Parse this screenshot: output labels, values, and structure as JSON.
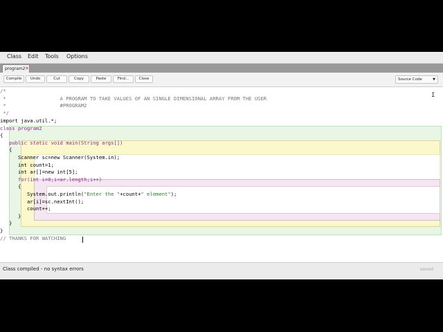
{
  "menu": [
    {
      "label": "Class"
    },
    {
      "label": "Edit"
    },
    {
      "label": "Tools"
    },
    {
      "label": "Options"
    }
  ],
  "tab": {
    "label": "program2",
    "close": "✕"
  },
  "toolbar": {
    "buttons": [
      {
        "label": "Compile"
      },
      {
        "label": "Undo"
      },
      {
        "label": "Cut"
      },
      {
        "label": "Copy"
      },
      {
        "label": "Paste"
      },
      {
        "label": "Find..."
      },
      {
        "label": "Close"
      }
    ],
    "view_select": "Source Code"
  },
  "code": {
    "lines": [
      {
        "cls": "cm",
        "text": "/*"
      },
      {
        "cls": "cm",
        "text": " *                  A PROGRAM TO TAKE VALUES OF AN SINGLE DIMENSIONAL ARRAY FROM THE USER"
      },
      {
        "cls": "cm",
        "text": " *                  #PROGRAM2"
      },
      {
        "cls": "cm",
        "text": " */"
      },
      {
        "cls": "",
        "text": "import java.util.*;"
      },
      {
        "cls": "kw",
        "text": "class program2"
      },
      {
        "cls": "",
        "text": "{"
      },
      {
        "cls": "kw",
        "text": "   public static void main(String args[])"
      },
      {
        "cls": "",
        "text": "   {"
      },
      {
        "cls": "",
        "text": "      Scanner sc=new Scanner(System.in);"
      },
      {
        "cls": "",
        "text": "      int count=1;"
      },
      {
        "cls": "",
        "text": "      int ar[]=new int[5];"
      },
      {
        "cls": "kw",
        "text": "      for(int i=0;i<ar.length;i++)"
      },
      {
        "cls": "",
        "text": "      {"
      },
      {
        "cls": "",
        "text": "         System.out.println(\"Enter the \"+count+\" element\");"
      },
      {
        "cls": "",
        "text": "         ar[i]=sc.nextInt();"
      },
      {
        "cls": "",
        "text": "         count++;"
      },
      {
        "cls": "",
        "text": "      }"
      },
      {
        "cls": "",
        "text": "   }"
      },
      {
        "cls": "",
        "text": "}"
      },
      {
        "cls": "cm",
        "text": "// THANKS FOR WATCHING"
      }
    ]
  },
  "status": {
    "message": "Class compiled - no syntax errors",
    "saved": "saved"
  }
}
